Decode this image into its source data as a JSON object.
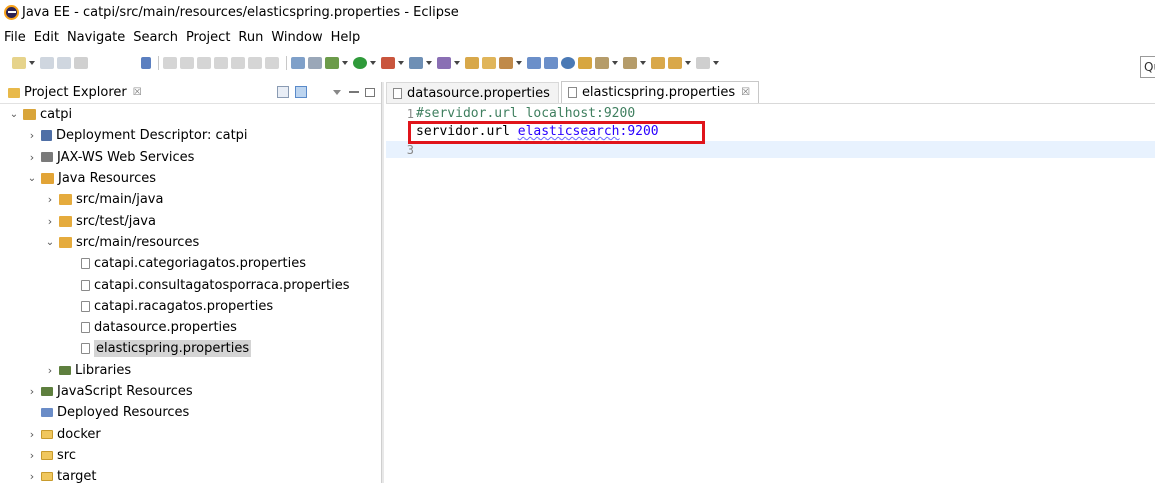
{
  "window": {
    "title": "Java EE - catpi/src/main/resources/elasticspring.properties - Eclipse"
  },
  "menubar": {
    "items": [
      "File",
      "Edit",
      "Navigate",
      "Search",
      "Project",
      "Run",
      "Window",
      "Help"
    ]
  },
  "toolbar": {
    "quick_access_text": "Qu"
  },
  "project_explorer": {
    "title": "Project Explorer",
    "close": "☒",
    "tree": [
      {
        "label": "catpi",
        "level": 0,
        "twisty": "open",
        "icon": "project-icon"
      },
      {
        "label": "Deployment Descriptor: catpi",
        "level": 1,
        "twisty": "closed",
        "icon": "deployment-descriptor-icon"
      },
      {
        "label": "JAX-WS Web Services",
        "level": 1,
        "twisty": "closed",
        "icon": "web-services-icon"
      },
      {
        "label": "Java Resources",
        "level": 1,
        "twisty": "open",
        "icon": "java-resources-icon"
      },
      {
        "label": "src/main/java",
        "level": 2,
        "twisty": "closed",
        "icon": "source-folder-icon"
      },
      {
        "label": "src/test/java",
        "level": 2,
        "twisty": "closed",
        "icon": "source-folder-icon"
      },
      {
        "label": "src/main/resources",
        "level": 2,
        "twisty": "open",
        "icon": "source-folder-icon"
      },
      {
        "label": "catapi.categoriagatos.properties",
        "level": 3,
        "twisty": "none",
        "icon": "properties-file-icon"
      },
      {
        "label": "catapi.consultagatosporraca.properties",
        "level": 3,
        "twisty": "none",
        "icon": "properties-file-icon"
      },
      {
        "label": "catapi.racagatos.properties",
        "level": 3,
        "twisty": "none",
        "icon": "properties-file-icon"
      },
      {
        "label": "datasource.properties",
        "level": 3,
        "twisty": "none",
        "icon": "properties-file-icon"
      },
      {
        "label": "elasticspring.properties",
        "level": 3,
        "twisty": "none",
        "icon": "properties-file-icon",
        "selected": true
      },
      {
        "label": "Libraries",
        "level": 2,
        "twisty": "closed",
        "icon": "libraries-icon"
      },
      {
        "label": "JavaScript Resources",
        "level": 1,
        "twisty": "closed",
        "icon": "javascript-resources-icon"
      },
      {
        "label": "Deployed Resources",
        "level": 1,
        "twisty": "none",
        "icon": "deployed-resources-icon"
      },
      {
        "label": "docker",
        "level": 1,
        "twisty": "closed",
        "icon": "folder-icon"
      },
      {
        "label": "src",
        "level": 1,
        "twisty": "closed",
        "icon": "folder-icon"
      },
      {
        "label": "target",
        "level": 1,
        "twisty": "closed",
        "icon": "folder-icon"
      }
    ]
  },
  "editor": {
    "tabs": [
      {
        "label": "datasource.properties",
        "active": false
      },
      {
        "label": "elasticspring.properties",
        "active": true,
        "close": "☒"
      }
    ],
    "lines": [
      {
        "number": "1",
        "comment": "#servidor.url localhost:9200"
      },
      {
        "number": "",
        "key": "servidor.url ",
        "value_underlined": "elasticsearch",
        "value_rest": ":9200"
      },
      {
        "number": "3"
      }
    ]
  }
}
